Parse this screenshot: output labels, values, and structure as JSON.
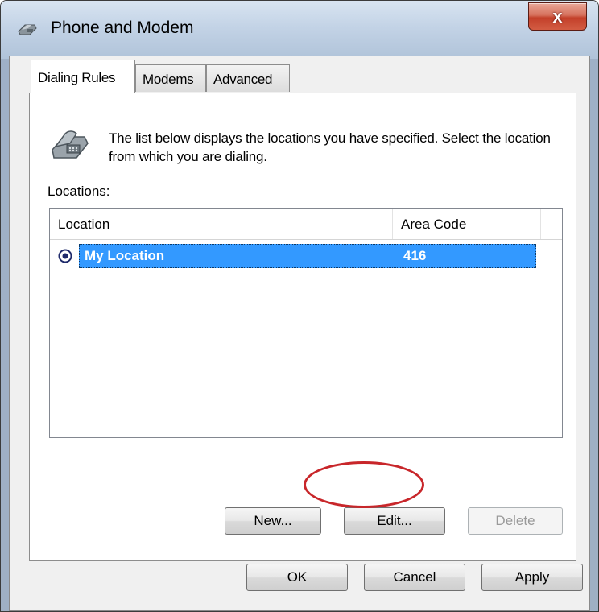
{
  "window": {
    "title": "Phone and Modem",
    "close_icon": "close-icon",
    "close_glyph": "x"
  },
  "tabs": [
    {
      "label": "Dialing Rules",
      "active": true
    },
    {
      "label": "Modems",
      "active": false
    },
    {
      "label": "Advanced",
      "active": false
    }
  ],
  "dialing_rules": {
    "intro_text": "The list below displays the locations you have specified. Select the location from which you are dialing.",
    "locations_label": "Locations:",
    "columns": [
      "Location",
      "Area Code"
    ],
    "rows": [
      {
        "location": "My Location",
        "area_code": "416",
        "selected": true,
        "default": true
      }
    ],
    "buttons": {
      "new": {
        "label": "New...",
        "enabled": true
      },
      "edit": {
        "label": "Edit...",
        "enabled": true
      },
      "delete": {
        "label": "Delete",
        "enabled": false
      }
    }
  },
  "footer_buttons": {
    "ok": "OK",
    "cancel": "Cancel",
    "apply": "Apply"
  },
  "colors": {
    "selection": "#3399ff",
    "annotation": "#c8262a",
    "close_button": "#c3402a"
  }
}
